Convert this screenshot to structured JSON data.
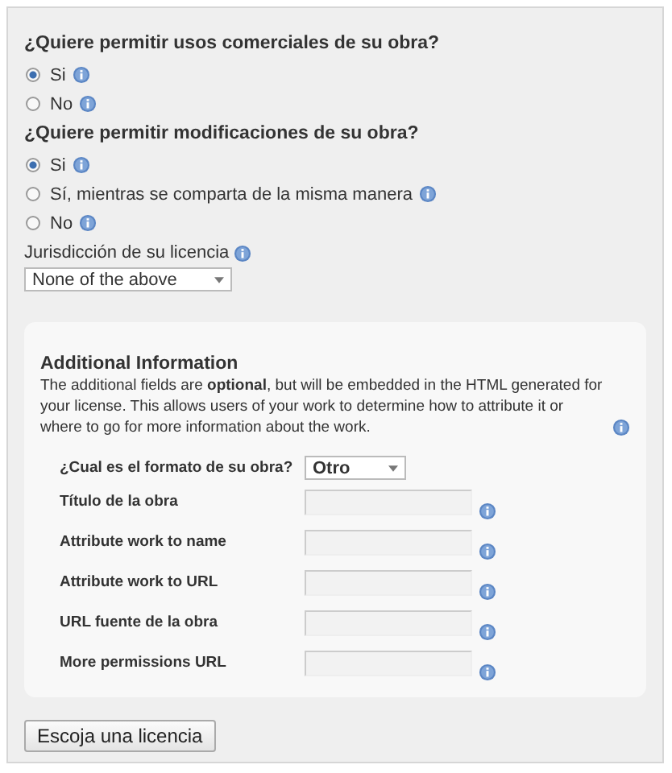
{
  "questions": [
    {
      "title": "¿Quiere permitir usos comerciales de su obra?",
      "options": [
        {
          "label": "Si",
          "selected": true
        },
        {
          "label": "No",
          "selected": false
        }
      ]
    },
    {
      "title": "¿Quiere permitir modificaciones de su obra?",
      "options": [
        {
          "label": "Si",
          "selected": true
        },
        {
          "label": "Sí, mientras se comparta de la misma manera",
          "selected": false
        },
        {
          "label": "No",
          "selected": false
        }
      ]
    }
  ],
  "jurisdiction": {
    "label": "Jurisdicción de su licencia",
    "value": "None of the above"
  },
  "additional": {
    "title": "Additional Information",
    "description": "The additional fields are **optional**, but will be embedded in the HTML generated for your license. This allows users of your work to determine how to attribute it or where to go for more information about the work.",
    "fields": [
      {
        "kind": "select",
        "label": "¿Cual es el formato de su obra?",
        "value": "Otro"
      },
      {
        "kind": "text",
        "label": "Título de la obra"
      },
      {
        "kind": "text",
        "label": "Attribute work to name"
      },
      {
        "kind": "text",
        "label": "Attribute work to URL"
      },
      {
        "kind": "text",
        "label": "URL fuente de la obra"
      },
      {
        "kind": "text",
        "label": "More permissions URL"
      }
    ]
  },
  "submit": "Escoja una licencia"
}
